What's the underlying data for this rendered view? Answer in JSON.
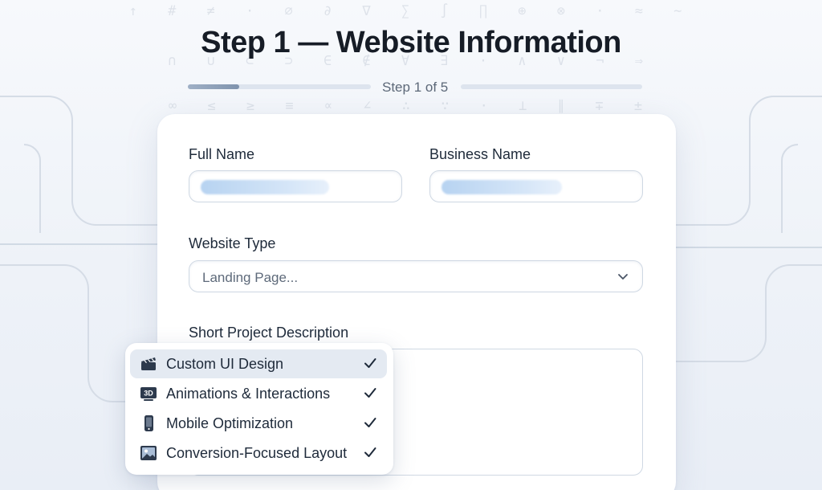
{
  "page": {
    "title": "Step 1 — Website Information"
  },
  "progress": {
    "label": "Step 1 of 5",
    "current_step": 1,
    "total_steps": 5,
    "fraction": 0.2
  },
  "form": {
    "full_name_label": "Full Name",
    "business_name_label": "Business Name",
    "website_type_label": "Website Type",
    "website_type_value": "Landing Page...",
    "description_label": "Short Project Description"
  },
  "features": {
    "items": [
      {
        "label": "Custom UI Design",
        "icon": "clapperboard-icon",
        "checked": true,
        "active": true
      },
      {
        "label": "Animations & Interactions",
        "icon": "3d-icon",
        "icon_text": "3D",
        "checked": true,
        "active": false
      },
      {
        "label": "Mobile Optimization",
        "icon": "mobile-phone-icon",
        "checked": true,
        "active": false
      },
      {
        "label": "Conversion-Focused Layout",
        "icon": "image-icon",
        "checked": true,
        "active": false
      }
    ]
  },
  "colors": {
    "background": "#eef2f8",
    "card": "#ffffff",
    "title": "#161c26",
    "accent_fill": "#b7d3f1",
    "icon_dark": "#2d3a4d"
  }
}
